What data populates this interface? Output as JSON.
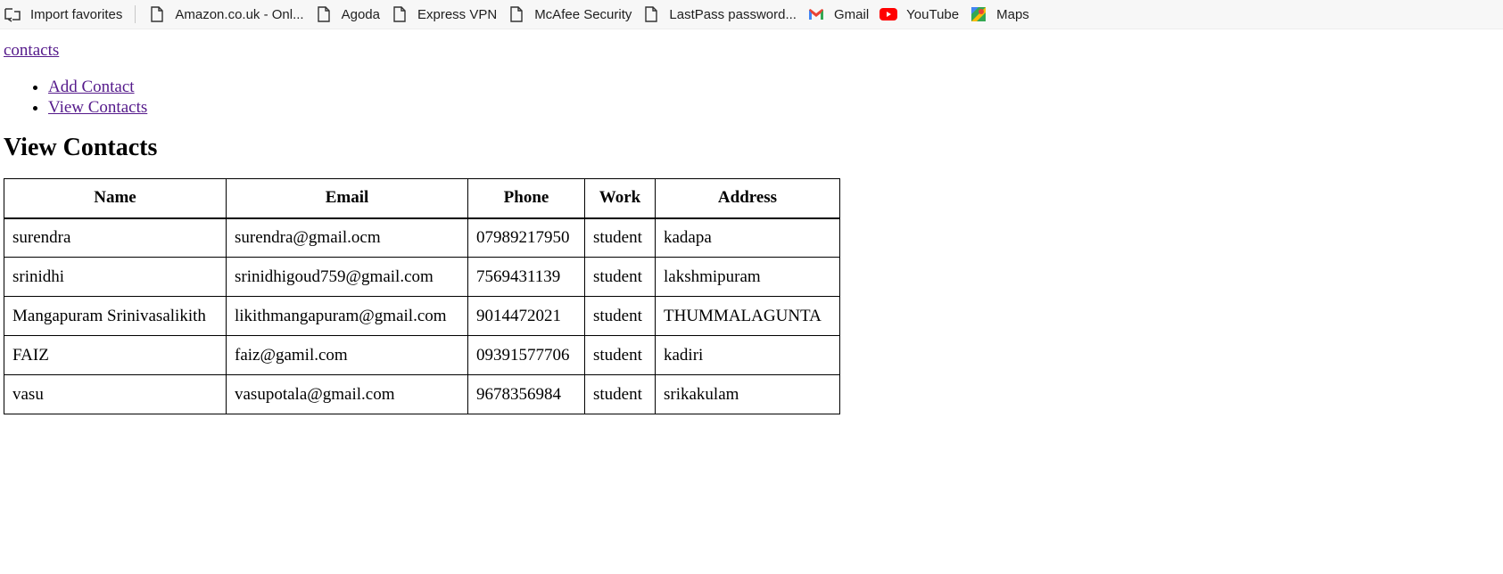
{
  "bookmarks": {
    "items": [
      {
        "label": "Import favorites",
        "icon": "import-icon"
      },
      {
        "label": "Amazon.co.uk - Onl...",
        "icon": "page-icon"
      },
      {
        "label": "Agoda",
        "icon": "page-icon"
      },
      {
        "label": "Express VPN",
        "icon": "page-icon"
      },
      {
        "label": "McAfee Security",
        "icon": "page-icon"
      },
      {
        "label": "LastPass password...",
        "icon": "page-icon"
      },
      {
        "label": "Gmail",
        "icon": "gmail-icon"
      },
      {
        "label": "YouTube",
        "icon": "youtube-icon"
      },
      {
        "label": "Maps",
        "icon": "maps-icon"
      }
    ]
  },
  "nav": {
    "brand": "contacts",
    "links": [
      "Add Contact",
      "View Contacts"
    ]
  },
  "main": {
    "heading": "View Contacts",
    "table": {
      "headers": [
        "Name",
        "Email",
        "Phone",
        "Work",
        "Address"
      ],
      "rows": [
        [
          "surendra",
          "surendra@gmail.ocm",
          "07989217950",
          "student",
          "kadapa"
        ],
        [
          "srinidhi",
          "srinidhigoud759@gmail.com",
          "7569431139",
          "student",
          "lakshmipuram"
        ],
        [
          "Mangapuram Srinivasalikith",
          "likithmangapuram@gmail.com",
          "9014472021",
          "student",
          "THUMMALAGUNTA"
        ],
        [
          "FAIZ",
          "faiz@gamil.com",
          "09391577706",
          "student",
          "kadiri"
        ],
        [
          "vasu",
          "vasupotala@gmail.com",
          "9678356984",
          "student",
          "srikakulam"
        ]
      ]
    }
  },
  "colors": {
    "link": "#551a8b",
    "bookmark_bar_bg": "#f7f7f7",
    "gmail_red": "#ea4335",
    "youtube_red": "#ff0000"
  }
}
